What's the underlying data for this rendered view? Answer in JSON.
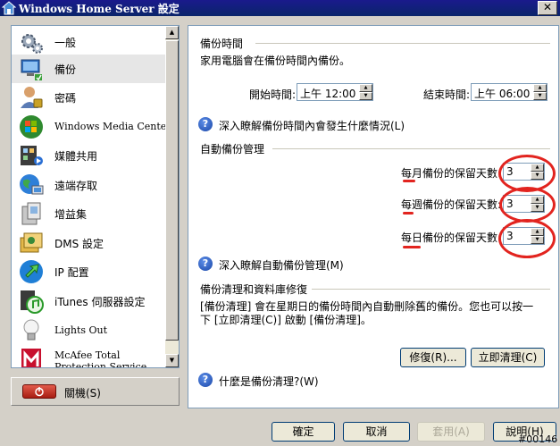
{
  "window": {
    "title": "Windows Home Server 設定"
  },
  "sidebar": {
    "items": [
      {
        "label": "一般",
        "icon": "gears-icon"
      },
      {
        "label": "備份",
        "icon": "backup-computer-icon",
        "selected": true
      },
      {
        "label": "密碼",
        "icon": "user-password-icon"
      },
      {
        "label": "Windows Media Center",
        "icon": "windows-media-center-icon"
      },
      {
        "label": "媒體共用",
        "icon": "media-sharing-icon"
      },
      {
        "label": "遠端存取",
        "icon": "remote-access-globe-icon"
      },
      {
        "label": "增益集",
        "icon": "add-ins-icon"
      },
      {
        "label": "DMS 設定",
        "icon": "dms-icon"
      },
      {
        "label": "IP 配置",
        "icon": "ip-arrow-icon"
      },
      {
        "label": "iTunes 伺服器設定",
        "icon": "itunes-icon"
      },
      {
        "label": "Lights Out",
        "icon": "lightbulb-icon"
      },
      {
        "label": "McAfee Total Protection Service",
        "icon": "mcafee-icon"
      }
    ],
    "shutdown_label": "關機(S)"
  },
  "backup_time": {
    "heading": "備份時間",
    "description": "家用電腦會在備份時間內備份。",
    "start_label": "開始時間:",
    "start_value": "上午 12:00",
    "end_label": "結束時間:",
    "end_value": "上午 06:00",
    "help_link": "深入瞭解備份時間內會發生什麼情況(L)"
  },
  "auto_backup": {
    "heading": "自動備份管理",
    "monthly_label": "每月備份的保留天數:",
    "monthly_value": "3",
    "weekly_label": "每週備份的保留天數:",
    "weekly_value": "3",
    "daily_label": "每日備份的保留天數:",
    "daily_value": "3",
    "help_link": "深入瞭解自動備份管理(M)"
  },
  "cleanup": {
    "heading": "備份清理和資料庫修復",
    "description_line1": "[備份清理] 會在星期日的備份時間內自動刪除舊的備份。您也可以按一",
    "description_line2": "下 [立即清理(C)] 啟動 [備份清理]。",
    "repair_button": "修復(R)...",
    "cleanup_button": "立即清理(C)",
    "help_link": "什麼是備份清理?(W)"
  },
  "footer": {
    "ok": "確定",
    "cancel": "取消",
    "apply": "套用(A)",
    "help": "說明(H)"
  },
  "watermark": "#00146",
  "colors": {
    "title_bar": "#0a246a",
    "annotation_red": "#e2241f",
    "panel_border": "#7f9db9"
  }
}
